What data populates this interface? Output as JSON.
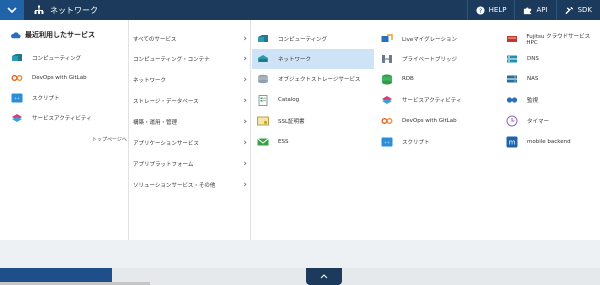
{
  "header": {
    "section_title": "ネットワーク",
    "actions": [
      {
        "label": "HELP"
      },
      {
        "label": "API"
      },
      {
        "label": "SDK"
      }
    ]
  },
  "recent": {
    "title": "最近利用したサービス",
    "items": [
      {
        "label": "コンピューティング",
        "icon": "compute-icon"
      },
      {
        "label": "DevOps with GitLab",
        "icon": "devops-icon"
      },
      {
        "label": "スクリプト",
        "icon": "script-icon"
      },
      {
        "label": "サービスアクティビティ",
        "icon": "activity-icon"
      }
    ],
    "top_link": "トップページへ"
  },
  "categories": [
    {
      "label": "すべてのサービス"
    },
    {
      "label": "コンピューティング・コンテナ"
    },
    {
      "label": "ネットワーク"
    },
    {
      "label": "ストレージ・データベース"
    },
    {
      "label": "構築・運用・管理"
    },
    {
      "label": "アプリケーションサービス"
    },
    {
      "label": "アプリプラットフォーム"
    },
    {
      "label": "ソリューションサービス・その他"
    }
  ],
  "services": {
    "col1": [
      {
        "label": "コンピューティング",
        "icon": "compute-icon"
      },
      {
        "label": "ネットワーク",
        "icon": "network-icon",
        "selected": true
      },
      {
        "label": "オブジェクトストレージサービス",
        "icon": "storage-icon"
      },
      {
        "label": "Catalog",
        "icon": "catalog-icon"
      },
      {
        "label": "SSL証明書",
        "icon": "ssl-icon"
      },
      {
        "label": "ESS",
        "icon": "mail-icon"
      }
    ],
    "col2": [
      {
        "label": "Liveマイグレーション",
        "icon": "migration-icon"
      },
      {
        "label": "プライベートブリッジ",
        "icon": "bridge-icon"
      },
      {
        "label": "RDB",
        "icon": "rdb-icon"
      },
      {
        "label": "サービスアクティビティ",
        "icon": "activity-icon"
      },
      {
        "label": "DevOps with GitLab",
        "icon": "devops-icon"
      },
      {
        "label": "スクリプト",
        "icon": "script-icon"
      }
    ],
    "col3": [
      {
        "label": "Fujitsu クラウドサービス HPC",
        "icon": "hpc-icon"
      },
      {
        "label": "DNS",
        "icon": "dns-icon"
      },
      {
        "label": "NAS",
        "icon": "nas-icon"
      },
      {
        "label": "監視",
        "icon": "monitor-icon"
      },
      {
        "label": "タイマー",
        "icon": "timer-icon"
      },
      {
        "label": "mobile backend",
        "icon": "mobile-backend-icon"
      }
    ]
  },
  "colors": {
    "topbar": "#1b3a5c",
    "accent": "#1f63a8",
    "selected_bg": "#cfe3f6"
  }
}
